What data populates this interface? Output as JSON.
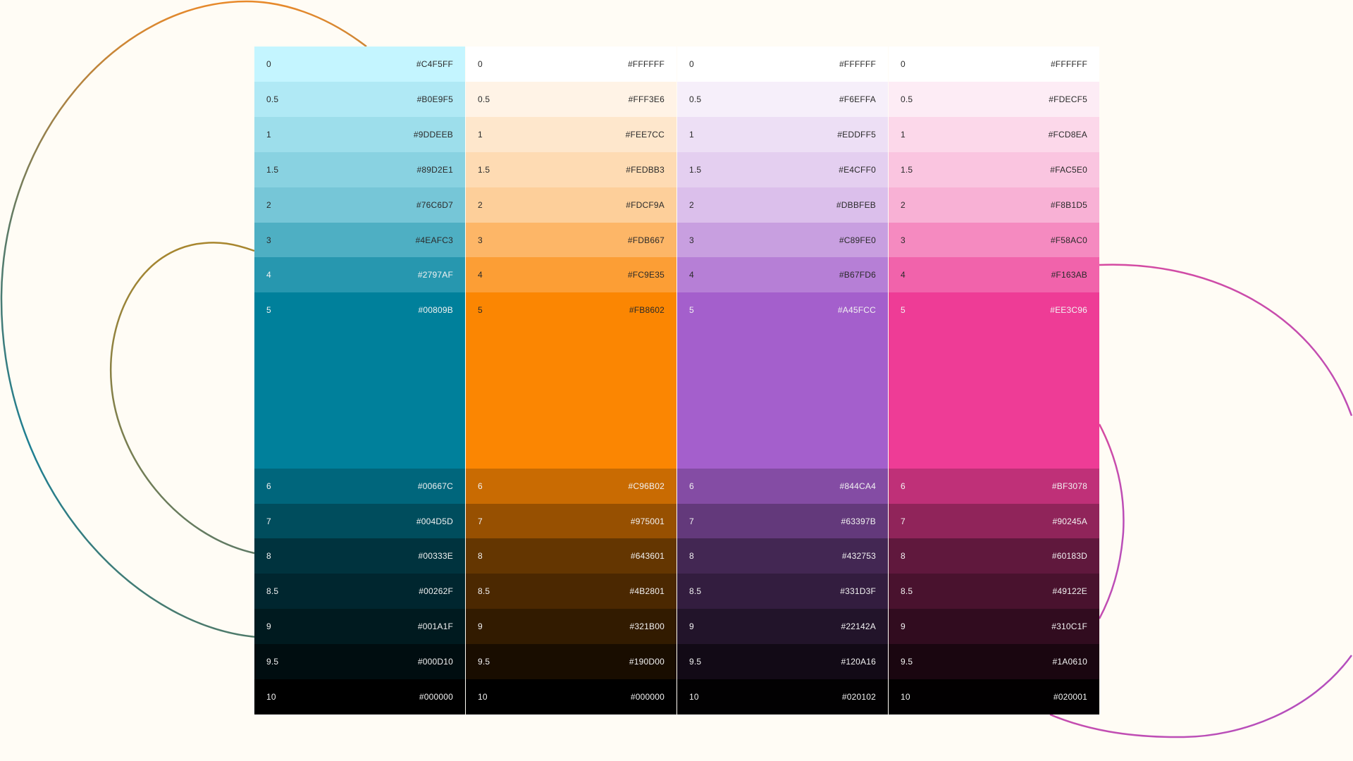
{
  "palette": {
    "columns": [
      {
        "name": "teal",
        "swatches": [
          {
            "step": "0",
            "hex": "#C4F5FF"
          },
          {
            "step": "0.5",
            "hex": "#B0E9F5"
          },
          {
            "step": "1",
            "hex": "#9DDEEB"
          },
          {
            "step": "1.5",
            "hex": "#89D2E1"
          },
          {
            "step": "2",
            "hex": "#76C6D7"
          },
          {
            "step": "3",
            "hex": "#4EAFC3"
          },
          {
            "step": "4",
            "hex": "#2797AF"
          },
          {
            "step": "5",
            "hex": "#00809B"
          },
          {
            "step": "6",
            "hex": "#00667C"
          },
          {
            "step": "7",
            "hex": "#004D5D"
          },
          {
            "step": "8",
            "hex": "#00333E"
          },
          {
            "step": "8.5",
            "hex": "#00262F"
          },
          {
            "step": "9",
            "hex": "#001A1F"
          },
          {
            "step": "9.5",
            "hex": "#000D10"
          },
          {
            "step": "10",
            "hex": "#000000"
          }
        ]
      },
      {
        "name": "orange",
        "swatches": [
          {
            "step": "0",
            "hex": "#FFFFFF"
          },
          {
            "step": "0.5",
            "hex": "#FFF3E6"
          },
          {
            "step": "1",
            "hex": "#FEE7CC"
          },
          {
            "step": "1.5",
            "hex": "#FEDBB3"
          },
          {
            "step": "2",
            "hex": "#FDCF9A"
          },
          {
            "step": "3",
            "hex": "#FDB667"
          },
          {
            "step": "4",
            "hex": "#FC9E35"
          },
          {
            "step": "5",
            "hex": "#FB8602"
          },
          {
            "step": "6",
            "hex": "#C96B02"
          },
          {
            "step": "7",
            "hex": "#975001"
          },
          {
            "step": "8",
            "hex": "#643601"
          },
          {
            "step": "8.5",
            "hex": "#4B2801"
          },
          {
            "step": "9",
            "hex": "#321B00"
          },
          {
            "step": "9.5",
            "hex": "#190D00"
          },
          {
            "step": "10",
            "hex": "#000000"
          }
        ]
      },
      {
        "name": "purple",
        "swatches": [
          {
            "step": "0",
            "hex": "#FFFFFF"
          },
          {
            "step": "0.5",
            "hex": "#F6EFFA"
          },
          {
            "step": "1",
            "hex": "#EDDFF5"
          },
          {
            "step": "1.5",
            "hex": "#E4CFF0"
          },
          {
            "step": "2",
            "hex": "#DBBFEB"
          },
          {
            "step": "3",
            "hex": "#C89FE0"
          },
          {
            "step": "4",
            "hex": "#B67FD6"
          },
          {
            "step": "5",
            "hex": "#A45FCC"
          },
          {
            "step": "6",
            "hex": "#844CA4"
          },
          {
            "step": "7",
            "hex": "#63397B"
          },
          {
            "step": "8",
            "hex": "#432753"
          },
          {
            "step": "8.5",
            "hex": "#331D3F"
          },
          {
            "step": "9",
            "hex": "#22142A"
          },
          {
            "step": "9.5",
            "hex": "#120A16"
          },
          {
            "step": "10",
            "hex": "#020102"
          }
        ]
      },
      {
        "name": "pink",
        "swatches": [
          {
            "step": "0",
            "hex": "#FFFFFF"
          },
          {
            "step": "0.5",
            "hex": "#FDECF5"
          },
          {
            "step": "1",
            "hex": "#FCD8EA"
          },
          {
            "step": "1.5",
            "hex": "#FAC5E0"
          },
          {
            "step": "2",
            "hex": "#F8B1D5"
          },
          {
            "step": "3",
            "hex": "#F58AC0"
          },
          {
            "step": "4",
            "hex": "#F163AB"
          },
          {
            "step": "5",
            "hex": "#EE3C96"
          },
          {
            "step": "6",
            "hex": "#BF3078"
          },
          {
            "step": "7",
            "hex": "#90245A"
          },
          {
            "step": "8",
            "hex": "#60183D"
          },
          {
            "step": "8.5",
            "hex": "#49122E"
          },
          {
            "step": "9",
            "hex": "#310C1F"
          },
          {
            "step": "9.5",
            "hex": "#1A0610"
          },
          {
            "step": "10",
            "hex": "#020001"
          }
        ]
      }
    ]
  },
  "colors": {
    "background": "#FFFCF5",
    "curve_orange": "#E8892A",
    "curve_teal": "#1E7F93",
    "curve_olive": "#7A7A4A",
    "curve_magenta": "#C74BB5"
  }
}
